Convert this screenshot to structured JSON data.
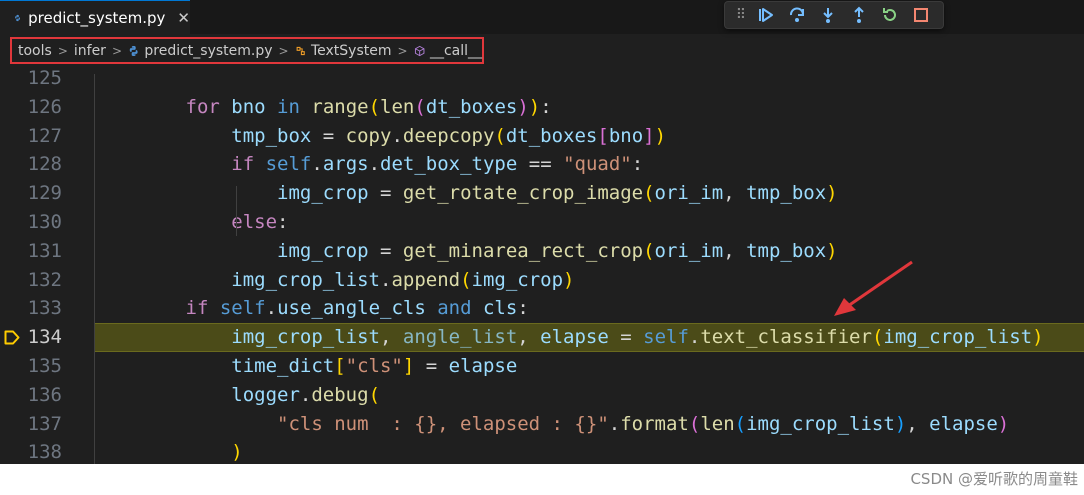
{
  "tab": {
    "label": "predict_system.py",
    "close": "✕"
  },
  "debug_toolbar": {
    "buttons": [
      "continue",
      "step-over",
      "step-into",
      "step-out",
      "restart",
      "stop"
    ]
  },
  "breadcrumb": {
    "items": [
      "tools",
      "infer",
      "predict_system.py",
      "TextSystem",
      "__call__"
    ]
  },
  "editor": {
    "current_line": 134,
    "lines": [
      {
        "num": "125",
        "tokens": []
      },
      {
        "num": "126",
        "tokens": [
          [
            "kw",
            "        for "
          ],
          [
            "vr",
            "bno "
          ],
          [
            "kw2",
            "in "
          ],
          [
            "fn",
            "range"
          ],
          [
            "br1",
            "("
          ],
          [
            "fn",
            "len"
          ],
          [
            "br2",
            "("
          ],
          [
            "vr",
            "dt_boxes"
          ],
          [
            "br2",
            ")"
          ],
          [
            "br1",
            ")"
          ],
          [
            "op",
            ":"
          ]
        ]
      },
      {
        "num": "127",
        "tokens": [
          [
            "vr",
            "            tmp_box "
          ],
          [
            "op",
            "= "
          ],
          [
            "fn",
            "copy"
          ],
          [
            "op",
            "."
          ],
          [
            "fn",
            "deepcopy"
          ],
          [
            "br1",
            "("
          ],
          [
            "vr",
            "dt_boxes"
          ],
          [
            "br2",
            "["
          ],
          [
            "vr",
            "bno"
          ],
          [
            "br2",
            "]"
          ],
          [
            "br1",
            ")"
          ]
        ]
      },
      {
        "num": "128",
        "tokens": [
          [
            "kw",
            "            if "
          ],
          [
            "kw2",
            "self"
          ],
          [
            "op",
            "."
          ],
          [
            "vr",
            "args"
          ],
          [
            "op",
            "."
          ],
          [
            "vr",
            "det_box_type "
          ],
          [
            "op",
            "== "
          ],
          [
            "st",
            "\"quad\""
          ],
          [
            "op",
            ":"
          ]
        ]
      },
      {
        "num": "129",
        "tokens": [
          [
            "vr",
            "                img_crop "
          ],
          [
            "op",
            "= "
          ],
          [
            "fn",
            "get_rotate_crop_image"
          ],
          [
            "br1",
            "("
          ],
          [
            "vr",
            "ori_im"
          ],
          [
            "op",
            ", "
          ],
          [
            "vr",
            "tmp_box"
          ],
          [
            "br1",
            ")"
          ]
        ]
      },
      {
        "num": "130",
        "tokens": [
          [
            "kw",
            "            else"
          ],
          [
            "op",
            ":"
          ]
        ]
      },
      {
        "num": "131",
        "tokens": [
          [
            "vr",
            "                img_crop "
          ],
          [
            "op",
            "= "
          ],
          [
            "fn",
            "get_minarea_rect_crop"
          ],
          [
            "br1",
            "("
          ],
          [
            "vr",
            "ori_im"
          ],
          [
            "op",
            ", "
          ],
          [
            "vr",
            "tmp_box"
          ],
          [
            "br1",
            ")"
          ]
        ]
      },
      {
        "num": "132",
        "tokens": [
          [
            "vr",
            "            img_crop_list"
          ],
          [
            "op",
            "."
          ],
          [
            "fn",
            "append"
          ],
          [
            "br1",
            "("
          ],
          [
            "vr",
            "img_crop"
          ],
          [
            "br1",
            ")"
          ]
        ]
      },
      {
        "num": "133",
        "tokens": [
          [
            "kw",
            "        if "
          ],
          [
            "kw2",
            "self"
          ],
          [
            "op",
            "."
          ],
          [
            "vr",
            "use_angle_cls "
          ],
          [
            "kw2",
            "and "
          ],
          [
            "vr",
            "cls"
          ],
          [
            "op",
            ":"
          ]
        ]
      },
      {
        "num": "134",
        "tokens": [
          [
            "vr",
            "            img_crop_list"
          ],
          [
            "op",
            ", "
          ],
          [
            "dim",
            "angle_list"
          ],
          [
            "op",
            ", "
          ],
          [
            "vr",
            "elapse "
          ],
          [
            "op",
            "= "
          ],
          [
            "kw2",
            "self"
          ],
          [
            "op",
            "."
          ],
          [
            "fn",
            "text_classifier"
          ],
          [
            "br1",
            "("
          ],
          [
            "vr",
            "img_crop_list"
          ],
          [
            "br1",
            ")"
          ]
        ]
      },
      {
        "num": "135",
        "tokens": [
          [
            "vr",
            "            time_dict"
          ],
          [
            "br1",
            "["
          ],
          [
            "st",
            "\"cls\""
          ],
          [
            "br1",
            "]"
          ],
          [
            "op",
            " = "
          ],
          [
            "vr",
            "elapse"
          ]
        ]
      },
      {
        "num": "136",
        "tokens": [
          [
            "vr",
            "            logger"
          ],
          [
            "op",
            "."
          ],
          [
            "fn",
            "debug"
          ],
          [
            "br1",
            "("
          ]
        ]
      },
      {
        "num": "137",
        "tokens": [
          [
            "st",
            "                \"cls num  : {}, elapsed : {}\""
          ],
          [
            "op",
            "."
          ],
          [
            "fn",
            "format"
          ],
          [
            "br2",
            "("
          ],
          [
            "fn",
            "len"
          ],
          [
            "br3",
            "("
          ],
          [
            "vr",
            "img_crop_list"
          ],
          [
            "br3",
            ")"
          ],
          [
            "op",
            ", "
          ],
          [
            "vr",
            "elapse"
          ],
          [
            "br2",
            ")"
          ]
        ]
      },
      {
        "num": "138",
        "tokens": [
          [
            "br1",
            "            )"
          ]
        ]
      }
    ]
  },
  "watermark": "CSDN @爱听歌的周童鞋",
  "colors": {
    "accent": "#0078d4",
    "highlight": "#4b4b18",
    "annotation": "#e0373b"
  }
}
